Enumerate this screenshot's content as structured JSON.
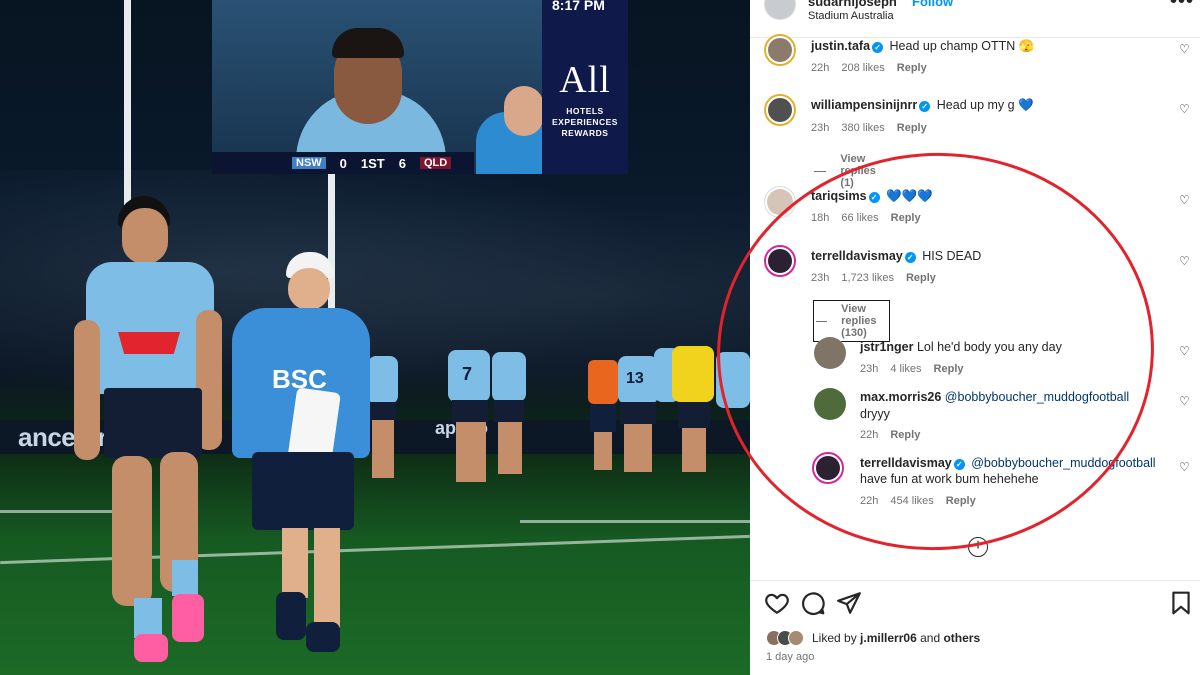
{
  "post": {
    "username": "sudarnijoseph",
    "follow_label": "Follow",
    "location": "Stadium Australia",
    "more_label": "•••"
  },
  "photo": {
    "screen_time": "8:17 PM",
    "score": {
      "team1": "NSW",
      "score1": "0",
      "period": "1ST",
      "score2": "6",
      "team2": "QLD"
    },
    "ad_logo": "All",
    "ad_sub": "HOTELS\nEXPERIENCES\nREWARDS",
    "board_left": "ancestry",
    "board_right": "apollo",
    "jersey_numbers": [
      "7",
      "13"
    ],
    "sponsor": "BSC"
  },
  "comments": [
    {
      "user": "justin.tafa",
      "verified": true,
      "text": "Head up champ OTTN 🫣",
      "time": "22h",
      "likes": "208 likes",
      "reply": "Reply"
    },
    {
      "user": "williampensinijnrr",
      "verified": true,
      "text": "Head up my g 💙",
      "time": "23h",
      "likes": "380 likes",
      "reply": "Reply",
      "view_replies": "View replies (1)"
    },
    {
      "user": "tariqsims",
      "verified": true,
      "text": "💙💙💙",
      "time": "18h",
      "likes": "66 likes",
      "reply": "Reply"
    },
    {
      "user": "terrelldavismay",
      "verified": true,
      "text": "HIS DEAD",
      "time": "23h",
      "likes": "1,723 likes",
      "reply": "Reply",
      "view_replies": "View replies (130)"
    }
  ],
  "replies": [
    {
      "user": "jstr1nger",
      "verified": false,
      "text": "Lol he'd body you any day",
      "time": "23h",
      "likes": "4 likes",
      "reply": "Reply"
    },
    {
      "user": "max.morris26",
      "verified": false,
      "mention": "@bobbyboucher_muddogfootball",
      "text": "dryyy",
      "time": "22h",
      "reply": "Reply"
    },
    {
      "user": "terrelldavismay",
      "verified": true,
      "mention": "@bobbyboucher_muddogfootball",
      "text": "have fun at work bum hehehehe",
      "time": "22h",
      "likes": "454 likes",
      "reply": "Reply"
    }
  ],
  "footer": {
    "liked_by_prefix": "Liked by",
    "liked_by_user": "j.millerr06",
    "liked_by_and": "and",
    "liked_by_others": "others",
    "time_ago": "1 day ago"
  },
  "colors": {
    "accent": "#0095f6",
    "annotation": "#e3232c",
    "text": "#262626",
    "muted": "#737373"
  }
}
